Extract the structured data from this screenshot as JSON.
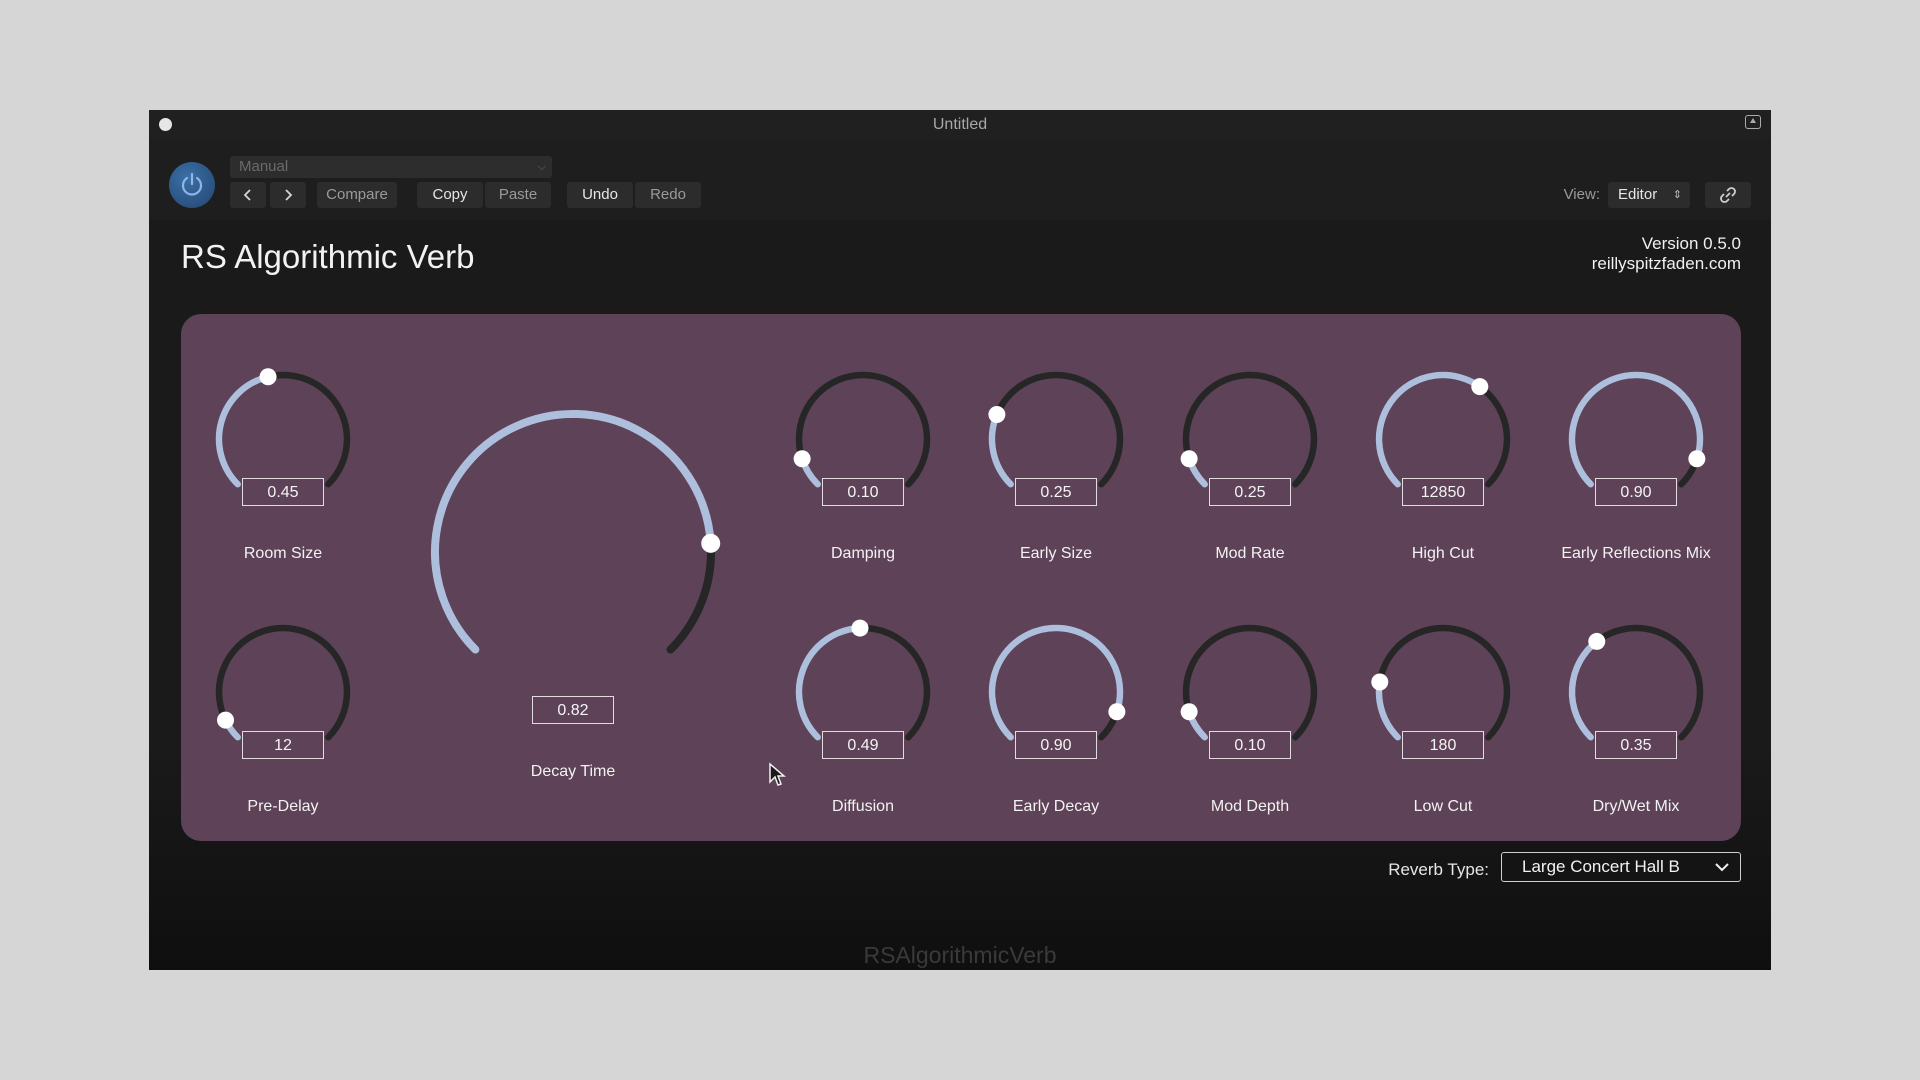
{
  "window": {
    "title": "Untitled"
  },
  "toolbar": {
    "preset": "Manual",
    "prev_icon": "chevron-left-icon",
    "next_icon": "chevron-right-icon",
    "compare": "Compare",
    "copy": "Copy",
    "paste": "Paste",
    "undo": "Undo",
    "redo": "Redo",
    "view_label": "View:",
    "view_value": "Editor",
    "link_icon": "link-icon"
  },
  "plugin": {
    "name": "RS Algorithmic Verb",
    "version": "Version 0.5.0",
    "website": "reillyspitzfaden.com",
    "footer": "RSAlgorithmicVerb",
    "accent": "#aebfdd",
    "panel_color": "#5e4257"
  },
  "knobs": {
    "room_size": {
      "label": "Room Size",
      "value": "0.45",
      "level": 0.45
    },
    "pre_delay": {
      "label": "Pre-Delay",
      "value": "12",
      "level": 0.07
    },
    "decay_time": {
      "label": "Decay Time",
      "value": "0.82",
      "level": 0.82
    },
    "damping": {
      "label": "Damping",
      "value": "0.10",
      "level": 0.1
    },
    "early_size": {
      "label": "Early Size",
      "value": "0.25",
      "level": 0.25
    },
    "mod_rate": {
      "label": "Mod Rate",
      "value": "0.25",
      "level": 0.1
    },
    "high_cut": {
      "label": "High Cut",
      "value": "12850",
      "level": 0.63
    },
    "early_reflections_mix": {
      "label": "Early Reflections Mix",
      "value": "0.90",
      "level": 0.9
    },
    "diffusion": {
      "label": "Diffusion",
      "value": "0.49",
      "level": 0.49
    },
    "early_decay": {
      "label": "Early Decay",
      "value": "0.90",
      "level": 0.9
    },
    "mod_depth": {
      "label": "Mod Depth",
      "value": "0.10",
      "level": 0.1
    },
    "low_cut": {
      "label": "Low Cut",
      "value": "180",
      "level": 0.2
    },
    "dry_wet_mix": {
      "label": "Dry/Wet Mix",
      "value": "0.35",
      "level": 0.36
    }
  },
  "reverb": {
    "label": "Reverb Type:",
    "value": "Large Concert Hall B"
  }
}
